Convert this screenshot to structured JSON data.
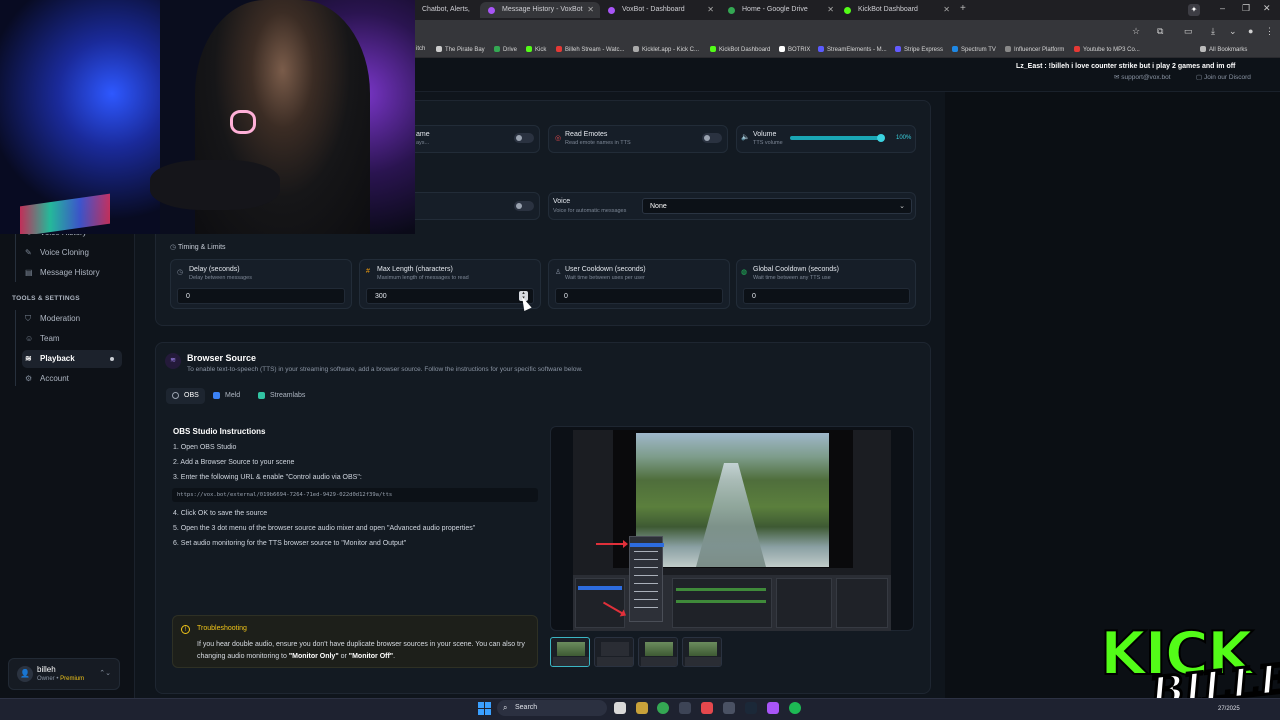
{
  "browser": {
    "tabs": [
      {
        "title": "Chatbot, Alerts,",
        "active": false,
        "color": "#6b6b6b"
      },
      {
        "title": "Message History - VoxBot",
        "active": true,
        "color": "#a855f7"
      },
      {
        "title": "VoxBot - Dashboard",
        "active": false,
        "color": "#a855f7"
      },
      {
        "title": "Home - Google Drive",
        "active": false,
        "color": "#34a853"
      },
      {
        "title": "KickBot Dashboard",
        "active": false,
        "color": "#53fc18"
      }
    ],
    "bookmarks": [
      {
        "label": "itch",
        "color": "#888888"
      },
      {
        "label": "The Pirate Bay",
        "color": "#cccccc"
      },
      {
        "label": "Drive",
        "color": "#34a853"
      },
      {
        "label": "Kick",
        "color": "#53fc18"
      },
      {
        "label": "Billeh Stream - Watc...",
        "color": "#e53935"
      },
      {
        "label": "Kicklet.app - Kick C...",
        "color": "#aaaaaa"
      },
      {
        "label": "KickBot Dashboard",
        "color": "#53fc18"
      },
      {
        "label": "BOTRIX",
        "color": "#ffffff"
      },
      {
        "label": "StreamElements - M...",
        "color": "#5b5bff"
      },
      {
        "label": "Stripe Express",
        "color": "#635bff"
      },
      {
        "label": "Spectrum TV",
        "color": "#1e88e5"
      },
      {
        "label": "Influencer Platform",
        "color": "#888888"
      },
      {
        "label": "Youtube to MP3 Co...",
        "color": "#e53935"
      }
    ],
    "all_bookmarks": "All Bookmarks"
  },
  "header": {
    "ticker": "Lz_East : !billeh i love counter strike but i play 2 games and im off",
    "support": "support@vox.bot",
    "discord": "Join our Discord"
  },
  "sidebar": {
    "items": [
      {
        "label": "Voice History",
        "icon": "history-icon"
      },
      {
        "label": "Voice Cloning",
        "icon": "voice-clone-icon"
      },
      {
        "label": "Message History",
        "icon": "message-history-icon"
      }
    ],
    "section": "TOOLS & SETTINGS",
    "settings": [
      {
        "label": "Moderation",
        "icon": "shield-icon",
        "active": false
      },
      {
        "label": "Team",
        "icon": "team-icon",
        "active": false
      },
      {
        "label": "Playback",
        "icon": "waveform-icon",
        "active": true
      },
      {
        "label": "Account",
        "icon": "gear-icon",
        "active": false
      }
    ],
    "user": {
      "name": "billeh",
      "role": "Owner",
      "plan": "Premium",
      "separator": "•"
    }
  },
  "settings": {
    "row1": {
      "first_label": "ame",
      "first_sub": "ays...",
      "read_emotes": "Read Emotes",
      "read_emotes_sub": "Read emote names in TTS",
      "volume": "Volume",
      "volume_sub": "TTS volume",
      "volume_value": "100%",
      "volume_level": 1.0
    },
    "row2": {
      "voice": "Voice",
      "voice_sub": "Voice for automatic messages",
      "voice_selected": "None"
    },
    "timing": {
      "title": "Timing & Limits",
      "fields": [
        {
          "label": "Delay (seconds)",
          "sub": "Delay between messages",
          "value": "0",
          "icon": "clock-icon",
          "icon_color": "#7d8796"
        },
        {
          "label": "Max Length (characters)",
          "sub": "Maximum length of messages to read",
          "value": "300",
          "icon": "hash-icon",
          "icon_color": "#f59e0b"
        },
        {
          "label": "User Cooldown (seconds)",
          "sub": "Wait time between uses per user",
          "value": "0",
          "icon": "user-icon",
          "icon_color": "#7d8796"
        },
        {
          "label": "Global Cooldown (seconds)",
          "sub": "Wait time between any TTS use",
          "value": "0",
          "icon": "globe-icon",
          "icon_color": "#22c55e"
        }
      ]
    }
  },
  "browser_source": {
    "title": "Browser Source",
    "subtitle": "To enable text-to-speech (TTS) in your streaming software, add a browser source. Follow the instructions for your specific software below.",
    "tabs": [
      {
        "label": "OBS",
        "color": "#9aa3b0",
        "active": true
      },
      {
        "label": "Meld",
        "color": "#3b82f6",
        "active": false
      },
      {
        "label": "Streamlabs",
        "color": "#31c3a2",
        "active": false
      }
    ],
    "instructions_title": "OBS Studio Instructions",
    "steps": [
      "1. Open OBS Studio",
      "2. Add a Browser Source to your scene",
      "3. Enter the following URL & enable \"Control audio via OBS\":",
      "4. Click OK to save the source",
      "5. Open the 3 dot menu of the browser source audio mixer and open \"Advanced audio properties\"",
      "6. Set audio monitoring for the TTS browser source to \"Monitor and Output\""
    ],
    "url": "https://vox.bot/external/019b6694-7264-71ed-9429-022d0d12f39a/tts",
    "troubleshooting": {
      "title": "Troubleshooting",
      "text_a": "If you hear double audio, ensure you don't have duplicate browser sources in your scene. You can also try changing audio monitoring to ",
      "opt1": "\"Monitor Only\"",
      "or": " or ",
      "opt2": "\"Monitor Off\"",
      "end": "."
    }
  },
  "taskbar": {
    "search": "Search",
    "time": "",
    "date": "27/2025"
  },
  "overlay": {
    "logo_kick": "KICK",
    "logo_name": "BILLEH"
  }
}
